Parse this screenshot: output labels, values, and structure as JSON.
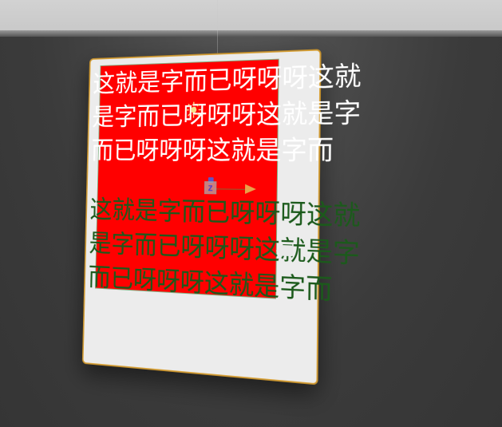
{
  "scene": {
    "white_text": "这就是字而已呀呀呀这就\n是字而已呀呀呀这就是字\n而已呀呀呀这就是字而",
    "green_text": "这就是字而已呀呀呀这就\n是字而已呀呀呀这就是字\n而已呀呀呀这就是字而",
    "gizmo_axis_label": "z",
    "colors": {
      "panel": "#ff0000",
      "canvas_border": "#d8a23a",
      "white_text": "#ffffff",
      "green_text": "#1b5a1b"
    }
  }
}
